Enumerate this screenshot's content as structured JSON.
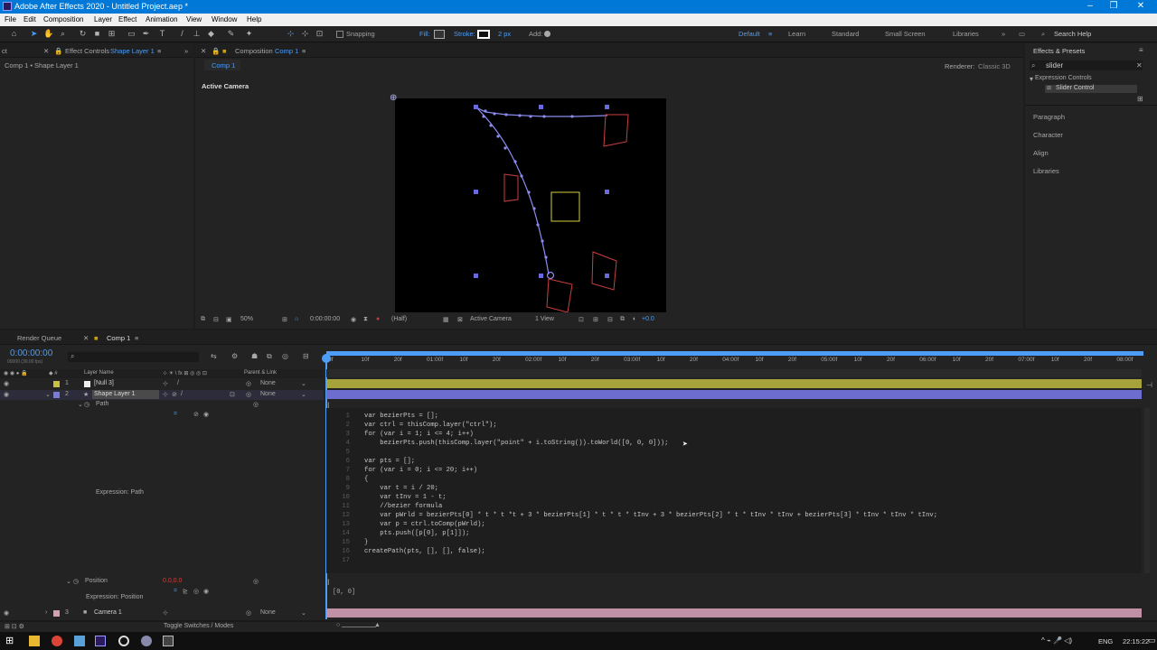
{
  "window": {
    "title": "Adobe After Effects 2020 - Untitled Project.aep *",
    "controls": [
      "–",
      "❐",
      "✕"
    ]
  },
  "menu": [
    "File",
    "Edit",
    "Composition",
    "Layer",
    "Effect",
    "Animation",
    "View",
    "Window",
    "Help"
  ],
  "toolbar": {
    "snapping": "Snapping",
    "fill": "Fill:",
    "stroke": "Stroke:",
    "stroke_width": "2 px",
    "add": "Add:",
    "workspaces": [
      "Default",
      "Learn",
      "Standard",
      "Small Screen",
      "Libraries"
    ],
    "search_help": "Search Help"
  },
  "left_panel": {
    "tab_label": "Effect Controls",
    "tab_layer": "Shape Layer 1",
    "subtitle": "Comp 1 • Shape Layer 1"
  },
  "composition_panel": {
    "tab_label": "Composition",
    "tab_comp": "Comp 1",
    "subtab": "Comp 1",
    "renderer_label": "Renderer:",
    "renderer_value": "Classic 3D",
    "view_label": "Active Camera",
    "zoom": "50%",
    "timecode": "0:00:00:00",
    "resolution": "(Half)",
    "camera": "Active Camera",
    "views": "1 View",
    "exposure": "+0.0"
  },
  "effects_presets": {
    "title": "Effects & Presets",
    "search_value": "slider",
    "category": "Expression Controls",
    "item": "Slider Control",
    "panels": [
      "Paragraph",
      "Character",
      "Align",
      "Libraries"
    ]
  },
  "timeline": {
    "tabs": [
      "Render Queue",
      "Comp 1"
    ],
    "timecode": "0:00:00:00",
    "fps": "00000 (30.00 fps)",
    "col_layer_name": "Layer Name",
    "col_parent": "Parent & Link",
    "ruler": [
      "0f",
      "10f",
      "20f",
      "01:00f",
      "10f",
      "20f",
      "02:00f",
      "10f",
      "20f",
      "03:00f",
      "10f",
      "20f",
      "04:00f",
      "10f",
      "20f",
      "05:00f",
      "10f",
      "20f",
      "06:00f",
      "10f",
      "20f",
      "07:00f",
      "10f",
      "20f",
      "08:00f"
    ],
    "layers": [
      {
        "num": "1",
        "name": "[Null 3]",
        "parent": "None",
        "color": "#c8c040"
      },
      {
        "num": "2",
        "name": "Shape Layer 1",
        "parent": "None",
        "color": "#7a7ad8"
      },
      {
        "num": "3",
        "name": "Camera 1",
        "parent": "None",
        "color": "#d4a0b8"
      }
    ],
    "path_label": "Path",
    "expression_path": "Expression: Path",
    "position_label": "Position",
    "position_value": "0.0,0.0",
    "expression_position": "Expression: Position",
    "position_result": "[0, 0]",
    "footer": "Toggle Switches / Modes"
  },
  "code_lines": [
    {
      "n": "1",
      "t": "var bezierPts = [];"
    },
    {
      "n": "2",
      "t": "var ctrl = thisComp.layer(\"ctrl\");"
    },
    {
      "n": "3",
      "t": "for (var i = 1; i <= 4; i++)"
    },
    {
      "n": "4",
      "t": "    bezierPts.push(thisComp.layer(\"point\" + i.toString()).toWorld([0, 0, 0]));"
    },
    {
      "n": "5",
      "t": ""
    },
    {
      "n": "6",
      "t": "var pts = [];"
    },
    {
      "n": "7",
      "t": "for (var i = 0; i <= 20; i++)"
    },
    {
      "n": "8",
      "t": "{"
    },
    {
      "n": "9",
      "t": "    var t = i / 20;"
    },
    {
      "n": "10",
      "t": "    var tInv = 1 - t;"
    },
    {
      "n": "11",
      "t": "    //bezier formula"
    },
    {
      "n": "12",
      "t": "    var pWrld = bezierPts[0] * t * t *t + 3 * bezierPts[1] * t * t * tInv + 3 * bezierPts[2] * t * tInv * tInv + bezierPts[3] * tInv * tInv * tInv;"
    },
    {
      "n": "13",
      "t": "    var p = ctrl.toComp(pWrld);"
    },
    {
      "n": "14",
      "t": "    pts.push([p[0], p[1]]);"
    },
    {
      "n": "15",
      "t": "}"
    },
    {
      "n": "16",
      "t": "createPath(pts, [], [], false);"
    },
    {
      "n": "17",
      "t": ""
    }
  ],
  "taskbar": {
    "lang": "ENG",
    "time": "22:15:22"
  }
}
